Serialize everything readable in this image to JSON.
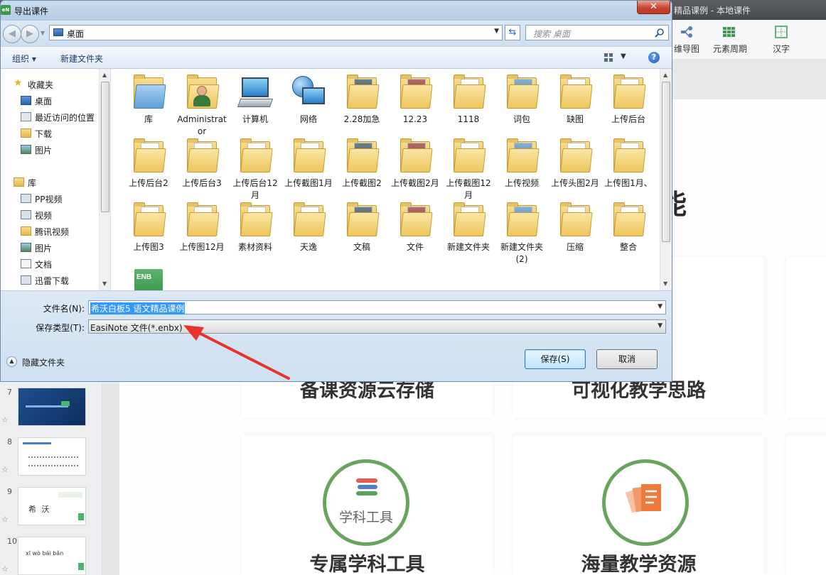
{
  "app": {
    "title": "精品课例 - 本地课件",
    "ribbon": [
      {
        "label": "维导图",
        "icon": "mindmap-icon"
      },
      {
        "label": "元素周期",
        "icon": "periodic-table-icon"
      },
      {
        "label": "汉字",
        "icon": "hanzi-icon"
      }
    ],
    "heading": "能",
    "cards": [
      {
        "title": "备课资源云存储"
      },
      {
        "title": "可视化教学思路"
      },
      {
        "title": "专属学科工具",
        "badge": "学科工具"
      },
      {
        "title": "海量教学资源"
      }
    ],
    "slides": [
      {
        "num": "7"
      },
      {
        "num": "8"
      },
      {
        "num": "9",
        "thumb_text": "希 沃"
      },
      {
        "num": "10",
        "thumb_text": "xī wò bái bǎn"
      }
    ],
    "accent_color": "#67a55d"
  },
  "dialog": {
    "app_icon_text": "eN",
    "title": "导出课件",
    "close_symbol": "✕",
    "address": "桌面",
    "search_placeholder": "搜索 桌面",
    "toolbar": {
      "organize": "组织 ▾",
      "new_folder": "新建文件夹",
      "help": "?"
    },
    "nav": {
      "favorites_header": "收藏夹",
      "favorites": [
        "桌面",
        "最近访问的位置",
        "下载",
        "图片"
      ],
      "library_header": "库",
      "libraries": [
        "PP视频",
        "视频",
        "腾讯视频",
        "图片",
        "文档",
        "迅雷下载"
      ]
    },
    "files": [
      {
        "name": "库",
        "icon": "library-folder-icon"
      },
      {
        "name": "Administrator",
        "icon": "user-folder-icon"
      },
      {
        "name": "计算机",
        "icon": "computer-icon"
      },
      {
        "name": "网络",
        "icon": "network-icon"
      },
      {
        "name": "2.28加急",
        "icon": "folder-icon"
      },
      {
        "name": "12.23",
        "icon": "folder-icon"
      },
      {
        "name": "1118",
        "icon": "folder-icon"
      },
      {
        "name": "词包",
        "icon": "folder-icon"
      },
      {
        "name": "缺图",
        "icon": "folder-icon"
      },
      {
        "name": "上传后台",
        "icon": "folder-icon"
      },
      {
        "name": "上传后台2",
        "icon": "folder-icon"
      },
      {
        "name": "上传后台3",
        "icon": "folder-icon"
      },
      {
        "name": "上传后台12月",
        "icon": "folder-icon"
      },
      {
        "name": "上传截图1月",
        "icon": "folder-icon"
      },
      {
        "name": "上传截图2",
        "icon": "folder-icon"
      },
      {
        "name": "上传截图2月",
        "icon": "folder-icon"
      },
      {
        "name": "上传截图12月",
        "icon": "folder-icon"
      },
      {
        "name": "上传视频",
        "icon": "folder-icon"
      },
      {
        "name": "上传头图2月",
        "icon": "folder-icon"
      },
      {
        "name": "上传图1月、",
        "icon": "folder-icon"
      },
      {
        "name": "上传图3",
        "icon": "folder-icon"
      },
      {
        "name": "上传图12月",
        "icon": "folder-icon"
      },
      {
        "name": "素材资料",
        "icon": "folder-icon"
      },
      {
        "name": "天逸",
        "icon": "folder-icon"
      },
      {
        "name": "文稿",
        "icon": "folder-icon"
      },
      {
        "name": "文件",
        "icon": "folder-icon"
      },
      {
        "name": "新建文件夹",
        "icon": "folder-icon"
      },
      {
        "name": "新建文件夹 (2)",
        "icon": "folder-icon"
      },
      {
        "name": "压缩",
        "icon": "folder-icon"
      },
      {
        "name": "整合",
        "icon": "folder-icon"
      },
      {
        "name": "",
        "icon": "enb-file-icon",
        "badge": "ENB"
      }
    ],
    "filename_label": "文件名(N):",
    "filename_value": "希沃白板5 语文精品课例",
    "filetype_label": "保存类型(T):",
    "filetype_value": "EasiNote 文件(*.enbx)",
    "save_button": "保存(S)",
    "cancel_button": "取消",
    "hide_folders": "隐藏文件夹"
  },
  "annotation": {
    "arrow_color": "#e8322a"
  }
}
